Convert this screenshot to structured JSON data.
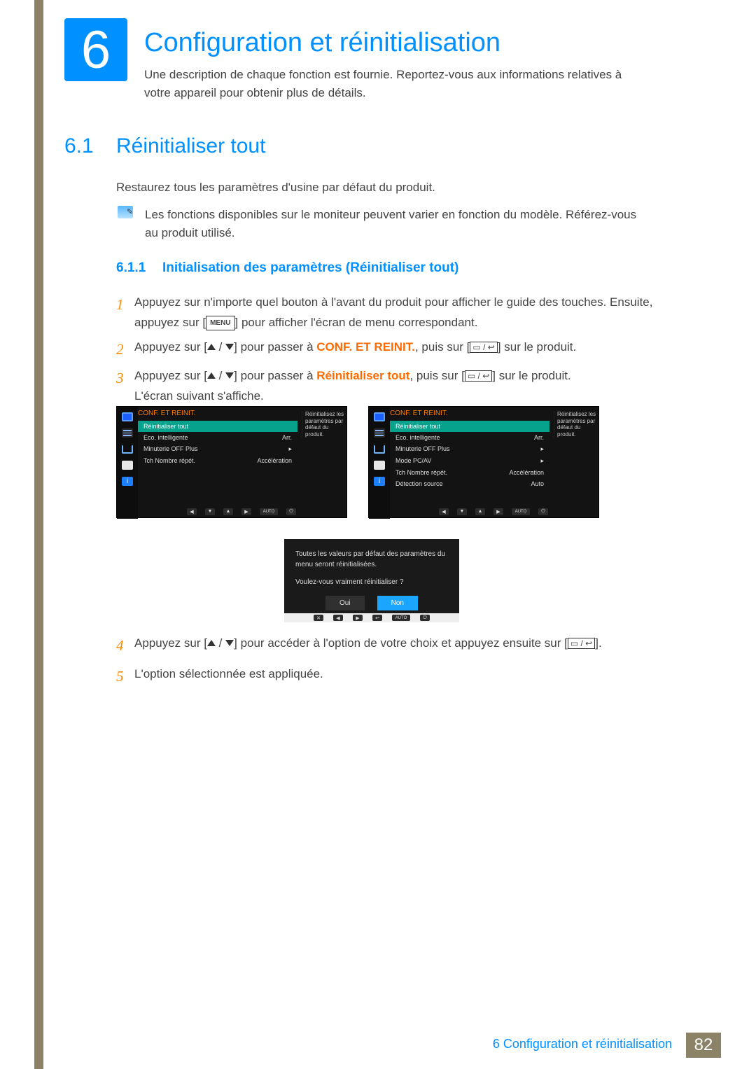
{
  "chapter": {
    "number": "6",
    "title": "Configuration et réinitialisation",
    "desc": "Une description de chaque fonction est fournie. Reportez-vous aux informations relatives à votre appareil pour obtenir plus de détails."
  },
  "section": {
    "number": "6.1",
    "title": "Réinitialiser tout",
    "para": "Restaurez tous les paramètres d'usine par défaut du produit.",
    "note": "Les fonctions disponibles sur le moniteur peuvent varier en fonction du modèle. Référez-vous au produit utilisé."
  },
  "subsection": {
    "number": "6.1.1",
    "title": "Initialisation des paramètres (Réinitialiser tout)"
  },
  "steps": {
    "s1a": "Appuyez sur n'importe quel bouton à l'avant du produit pour afficher le guide des touches. Ensuite, appuyez sur [",
    "s1b": "] pour afficher l'écran de menu correspondant.",
    "s2a": "Appuyez sur [",
    "s2b": "] pour passer à ",
    "s2_hl": "CONF. ET REINIT.",
    "s2c": ", puis sur [",
    "s2d": "] sur le produit.",
    "s3a": "Appuyez sur [",
    "s3b": "] pour passer à ",
    "s3_hl": "Réinitialiser tout",
    "s3c": ", puis sur [",
    "s3d": "] sur le produit.",
    "s3e": "L'écran suivant s'affiche.",
    "s4a": "Appuyez sur [",
    "s4b": "] pour accéder à l'option de votre choix et appuyez ensuite sur [",
    "s4c": "].",
    "s5": "L'option sélectionnée est appliquée.",
    "menu_label": "MENU"
  },
  "osd": {
    "header": "CONF. ET REINIT.",
    "hint": "Réinitialisez les paramètres par défaut du produit.",
    "auto_label": "AUTO",
    "left_rows": [
      {
        "label": "Réinitialiser tout",
        "value": "",
        "sel": true
      },
      {
        "label": "Eco. intelligente",
        "value": "Arr."
      },
      {
        "label": "Minuterie OFF Plus",
        "value": "▸"
      },
      {
        "label": "Tch Nombre répét.",
        "value": "Accélération"
      }
    ],
    "right_rows": [
      {
        "label": "Réinitialiser tout",
        "value": "",
        "sel": true
      },
      {
        "label": "Eco. intelligente",
        "value": "Arr."
      },
      {
        "label": "Minuterie OFF Plus",
        "value": "▸"
      },
      {
        "label": "Mode PC/AV",
        "value": "▸"
      },
      {
        "label": "Tch Nombre répét.",
        "value": "Accélération"
      },
      {
        "label": "Détection source",
        "value": "Auto"
      }
    ]
  },
  "dialog": {
    "line1": "Toutes les valeurs par défaut des paramètres du menu seront réinitialisées.",
    "line2": "Voulez-vous vraiment réinitialiser ?",
    "yes": "Oui",
    "no": "Non",
    "auto": "AUTO"
  },
  "footer": {
    "title": "6 Configuration et réinitialisation",
    "page": "82"
  }
}
